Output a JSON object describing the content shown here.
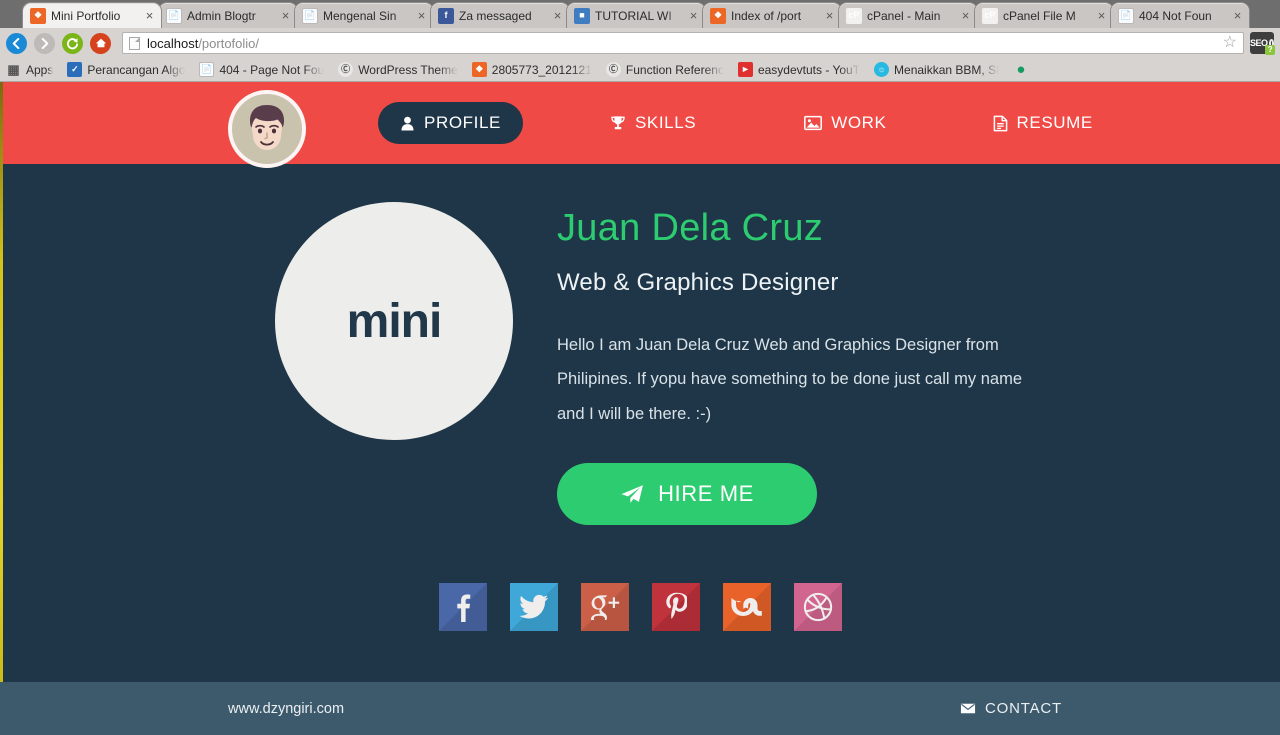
{
  "browser": {
    "tabs": [
      {
        "title": "Mini Portfolio",
        "favicon": "mini-icon",
        "active": true
      },
      {
        "title": "Admin Blogtr",
        "favicon": "document-icon",
        "active": false
      },
      {
        "title": "Mengenal Sin",
        "favicon": "document-icon",
        "active": false
      },
      {
        "title": "Za messaged",
        "favicon": "facebook-icon",
        "active": false
      },
      {
        "title": "TUTORIAL WI",
        "favicon": "tutorial-icon",
        "active": false
      },
      {
        "title": "Index of /port",
        "favicon": "mini-icon",
        "active": false
      },
      {
        "title": "cPanel - Main",
        "favicon": "cpanel-icon",
        "active": false
      },
      {
        "title": "cPanel File M",
        "favicon": "cpanel-icon",
        "active": false
      },
      {
        "title": "404 Not Foun",
        "favicon": "document-icon",
        "active": false
      }
    ],
    "tab_close_label": "×",
    "nav": {
      "back": "◀",
      "forward": "▶",
      "reload": "⟳",
      "home": "⌂"
    },
    "url": {
      "host": "localhost",
      "path": "/portofolio/"
    },
    "star_icon": "☆",
    "extension": {
      "label": "SEO",
      "badge": "?"
    },
    "bookmarks": [
      {
        "label": "Apps",
        "icon": "apps-grid-icon"
      },
      {
        "label": "Perancangan Algo",
        "icon": "checkmark-icon"
      },
      {
        "label": "404 - Page Not Fou",
        "icon": "document-icon"
      },
      {
        "label": "WordPress Theme",
        "icon": "wordpress-icon"
      },
      {
        "label": "2805773_2012121",
        "icon": "mini-icon"
      },
      {
        "label": "Function Referenc",
        "icon": "wordpress-icon"
      },
      {
        "label": "easydevtuts - YouT",
        "icon": "youtube-icon"
      },
      {
        "label": "Menaikkan BBM, SI",
        "icon": "bbm-icon"
      },
      {
        "label": "",
        "icon": "tux-icon"
      }
    ]
  },
  "site": {
    "header": {
      "avatar_name": "avatar-face",
      "nav": [
        {
          "label": "PROFILE",
          "icon": "user-icon",
          "active": true
        },
        {
          "label": "SKILLS",
          "icon": "trophy-icon",
          "active": false
        },
        {
          "label": "WORK",
          "icon": "image-icon",
          "active": false
        },
        {
          "label": "RESUME",
          "icon": "document-icon",
          "active": false
        }
      ]
    },
    "hero": {
      "logo_text": "mini",
      "name": "Juan Dela Cruz",
      "role": "Web & Graphics Designer",
      "bio": "Hello I am Juan Dela Cruz Web and Graphics Designer from Philipines. If yopu have something to be done just call my name and I will be there. :-)",
      "cta_label": "HIRE ME",
      "cta_icon": "paper-plane-icon"
    },
    "socials": [
      {
        "name": "facebook",
        "glyph": "f",
        "color": "#4a68a8"
      },
      {
        "name": "twitter",
        "glyph": "\u0000",
        "color": "#3fa8d8"
      },
      {
        "name": "googleplus",
        "glyph": "g⁺",
        "color": "#cc5f48"
      },
      {
        "name": "pinterest",
        "glyph": "\u0000",
        "color": "#c0323c"
      },
      {
        "name": "stumbleupon",
        "glyph": "\u0000",
        "color": "#e8622a"
      },
      {
        "name": "dribbble",
        "glyph": "\u0000",
        "color": "#d2658f"
      }
    ],
    "footer": {
      "site_url": "www.dzyngiri.com",
      "contact_label": "CONTACT",
      "contact_icon": "envelope-icon"
    }
  },
  "colors": {
    "header_red": "#ef4a46",
    "body_navy": "#1e3647",
    "accent_green": "#2ecc71",
    "footer_slate": "#3d5a6c"
  }
}
